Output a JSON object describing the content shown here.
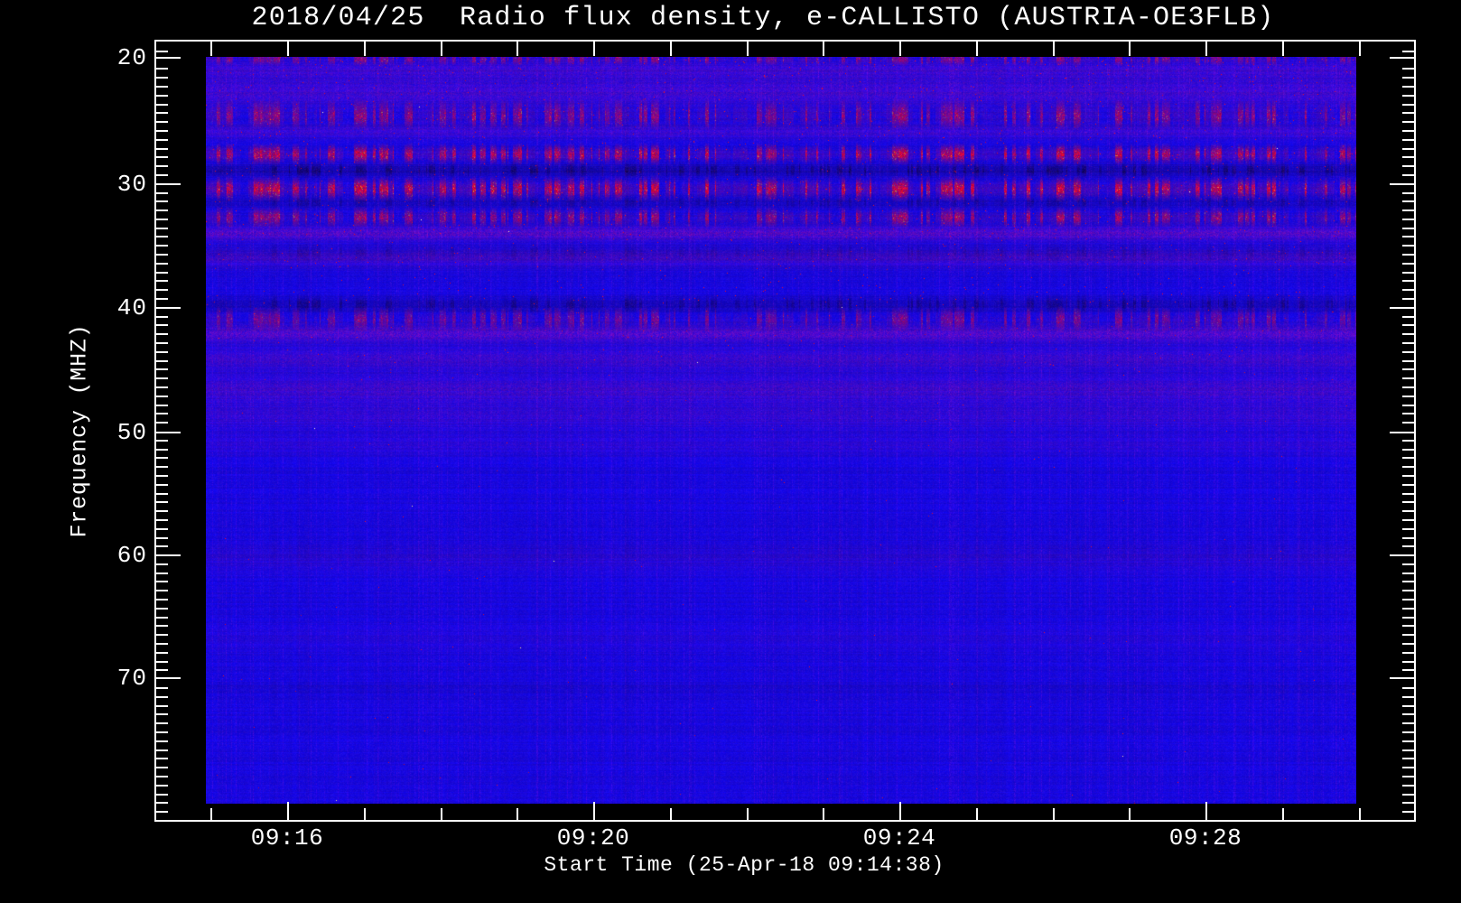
{
  "title": "2018/04/25  Radio flux density, e-CALLISTO (AUSTRIA-OE3FLB)",
  "x_axis": {
    "label": "Start Time (25-Apr-18 09:14:38)",
    "tick_labels": [
      "09:16",
      "09:20",
      "09:24",
      "09:28"
    ]
  },
  "y_axis": {
    "label": "Frequency (MHZ)",
    "tick_labels": [
      "20",
      "30",
      "40",
      "50",
      "60",
      "70"
    ]
  },
  "colors": {
    "background": "#000000",
    "foreground": "#ffffff",
    "quiet_flux_blue": "#1c11ee",
    "rfi_red": "#e81808",
    "dark_channel_navy": "#000060"
  },
  "chart_data": {
    "type": "heatmap",
    "title": "2018/04/25  Radio flux density, e-CALLISTO (AUSTRIA-OE3FLB)",
    "date": "2018/04/25",
    "instrument": "e-CALLISTO",
    "station": "AUSTRIA-OE3FLB",
    "xlabel": "Start Time (25-Apr-18 09:14:38)",
    "ylabel": "Frequency (MHZ)",
    "start_time": "09:14:38",
    "x_tick_labels": [
      "09:16",
      "09:20",
      "09:24",
      "09:28"
    ],
    "x_major_tick_interval_min": 4,
    "x_minor_tick_interval_min": 1,
    "x_span_min": 16.5,
    "y_ticks_mhz": [
      20,
      30,
      40,
      50,
      60,
      70
    ],
    "freq_range_mhz": [
      20,
      80.2
    ],
    "y_axis_direction": "frequency increases downward",
    "background_description": "uniform quiet-Sun blue with fine vertical time striations, no solar burst visible",
    "rfi_bands": [
      {
        "freq_mhz": 20.15,
        "sigma_mhz": 0.25,
        "type": "red_rfi",
        "strength": 0.55
      },
      {
        "freq_mhz": 21.0,
        "sigma_mhz": 0.5,
        "type": "purple_faint",
        "strength": 0.3
      },
      {
        "freq_mhz": 22.8,
        "sigma_mhz": 0.8,
        "type": "purple_faint",
        "strength": 0.35
      },
      {
        "freq_mhz": 24.2,
        "sigma_mhz": 0.5,
        "type": "red_rfi",
        "strength": 0.3
      },
      {
        "freq_mhz": 24.9,
        "sigma_mhz": 0.45,
        "type": "red_rfi",
        "strength": 0.5
      },
      {
        "freq_mhz": 26.0,
        "sigma_mhz": 0.4,
        "type": "purple_faint",
        "strength": 0.3
      },
      {
        "freq_mhz": 27.8,
        "sigma_mhz": 0.4,
        "type": "red_rfi",
        "strength": 0.9
      },
      {
        "freq_mhz": 29.1,
        "sigma_mhz": 0.35,
        "type": "dark_channel",
        "strength": 0.8
      },
      {
        "freq_mhz": 30.6,
        "sigma_mhz": 0.45,
        "type": "red_rfi",
        "strength": 1.0
      },
      {
        "freq_mhz": 31.7,
        "sigma_mhz": 0.3,
        "type": "dark_channel",
        "strength": 0.5
      },
      {
        "freq_mhz": 32.9,
        "sigma_mhz": 0.4,
        "type": "red_rfi",
        "strength": 0.7
      },
      {
        "freq_mhz": 34.2,
        "sigma_mhz": 0.4,
        "type": "purple_faint",
        "strength": 0.5
      },
      {
        "freq_mhz": 35.7,
        "sigma_mhz": 0.4,
        "type": "dark_channel",
        "strength": 0.35
      },
      {
        "freq_mhz": 36.2,
        "sigma_mhz": 0.5,
        "type": "purple_faint",
        "strength": 0.3
      },
      {
        "freq_mhz": 39.9,
        "sigma_mhz": 0.4,
        "type": "dark_channel",
        "strength": 0.65
      },
      {
        "freq_mhz": 41.1,
        "sigma_mhz": 0.5,
        "type": "red_rfi",
        "strength": 0.5
      },
      {
        "freq_mhz": 42.3,
        "sigma_mhz": 0.45,
        "type": "purple_faint",
        "strength": 0.5
      },
      {
        "freq_mhz": 44.3,
        "sigma_mhz": 0.6,
        "type": "purple_faint",
        "strength": 0.3
      },
      {
        "freq_mhz": 46.8,
        "sigma_mhz": 0.8,
        "type": "purple_faint",
        "strength": 0.32
      },
      {
        "freq_mhz": 49.0,
        "sigma_mhz": 0.7,
        "type": "purple_faint",
        "strength": 0.22
      },
      {
        "freq_mhz": 51.2,
        "sigma_mhz": 0.6,
        "type": "purple_faint",
        "strength": 0.15
      },
      {
        "freq_mhz": 59.6,
        "sigma_mhz": 0.7,
        "type": "dark_channel",
        "strength": 0.12
      },
      {
        "freq_mhz": 60.4,
        "sigma_mhz": 0.8,
        "type": "purple_faint",
        "strength": 0.12
      },
      {
        "freq_mhz": 66.8,
        "sigma_mhz": 0.8,
        "type": "purple_faint",
        "strength": 0.08
      },
      {
        "freq_mhz": 70.9,
        "sigma_mhz": 0.6,
        "type": "dark_channel",
        "strength": 0.1
      }
    ]
  }
}
